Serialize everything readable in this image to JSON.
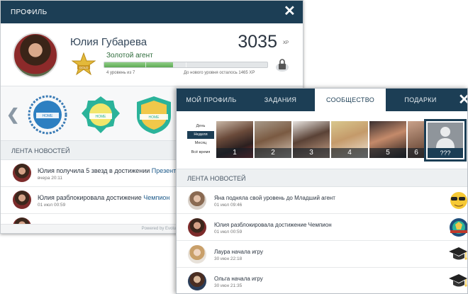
{
  "profile_window": {
    "title": "ПРОФИЛЬ",
    "user_name": "Юлия Губарева",
    "xp": "3035",
    "xp_unit": "XP",
    "rank": "Золотой агент",
    "level_text": "4 уровень из 7",
    "next_level_text": "До нового уровня осталось 1465 XP",
    "level_progress": 0.42,
    "rank_badge_text": "GOLD",
    "feed_title": "ЛЕНТА НОВОСТЕЙ",
    "feed": [
      {
        "text_prefix": "Юлия получила 5 звезд в достижении ",
        "highlight": "Презентация",
        "time": "вчера 20:11"
      },
      {
        "text_prefix": "Юлия разблокировала достижение ",
        "highlight": "Чемпион",
        "time": "01 июл 00:59"
      }
    ],
    "powered_by": "Powered by Evolution.Plus - GamiRe"
  },
  "community_window": {
    "tabs": [
      {
        "label": "МОЙ ПРОФИЛЬ",
        "active": false
      },
      {
        "label": "ЗАДАНИЯ",
        "active": false
      },
      {
        "label": "СООБЩЕСТВО",
        "active": true
      },
      {
        "label": "ПОДАРКИ",
        "active": false
      }
    ],
    "periods": [
      "День",
      "Неделя",
      "Месяц",
      "Всё время"
    ],
    "active_period": "Неделя",
    "top_players": [
      "1",
      "2",
      "3",
      "4",
      "5",
      "6"
    ],
    "current_player_rank": "???",
    "feed_title": "ЛЕНТА НОВОСТЕЙ",
    "feed": [
      {
        "prefix": "Яна подняла свой уровень до ",
        "highlight": "Младший агент",
        "time": "01 июл 09:46",
        "icon": "sunglasses-emoji-icon"
      },
      {
        "prefix": "Юлия разблокировала достижение ",
        "highlight": "Чемпион",
        "time": "01 июл 00:59",
        "icon": "champion-badge-icon"
      },
      {
        "prefix": "Лаура начала игру",
        "highlight": "",
        "time": "30 июн 22:18",
        "icon": "graduation-cap-icon"
      },
      {
        "prefix": "Ольга начала игру",
        "highlight": "",
        "time": "30 июн 21:35",
        "icon": "graduation-cap-icon"
      }
    ]
  },
  "colors": {
    "header_bg": "#1c3e55",
    "progress_green": "#5faa55",
    "badge_blue": "#2d7fc1",
    "badge_teal": "#2bb39a"
  }
}
